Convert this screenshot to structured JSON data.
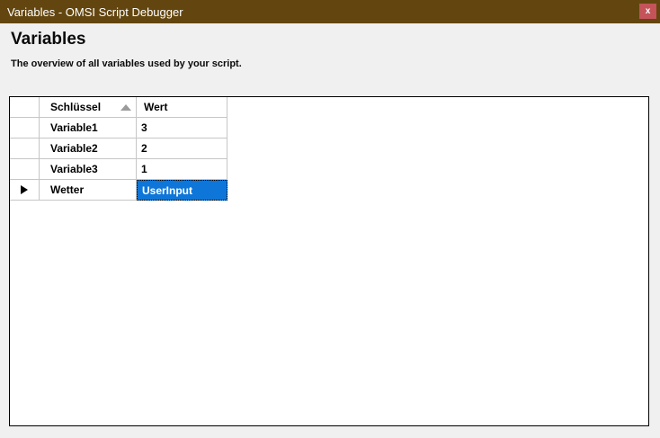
{
  "window": {
    "title": "Variables - OMSI Script Debugger",
    "close_label": "x"
  },
  "header": {
    "title": "Variables",
    "subtitle": "The overview of all variables used by your script."
  },
  "table": {
    "columns": [
      {
        "id": "selector",
        "label": ""
      },
      {
        "id": "schluessel",
        "label": "Schlüssel",
        "sort": "ascending"
      },
      {
        "id": "wert",
        "label": "Wert"
      }
    ],
    "rows": [
      {
        "schluessel": "Variable1",
        "wert": "3",
        "current": false,
        "wert_selected": false
      },
      {
        "schluessel": "Variable2",
        "wert": "2",
        "current": false,
        "wert_selected": false
      },
      {
        "schluessel": "Variable3",
        "wert": "1",
        "current": false,
        "wert_selected": false
      },
      {
        "schluessel": "Wetter",
        "wert": "UserInput",
        "current": true,
        "wert_selected": true
      }
    ]
  },
  "icons": {
    "sort_ascending": "triangle-up",
    "current_row": "triangle-right",
    "close": "x-icon"
  },
  "colors": {
    "titlebar_bg": "#63460f",
    "titlebar_text": "#ffffff",
    "close_button_bg": "#c4545a",
    "selection_bg": "#0e76d8",
    "selection_text": "#ffffff",
    "grid_line": "#c6c6c6",
    "panel_border": "#000000",
    "panel_bg": "#ffffff",
    "window_bg": "#f0f0f0"
  }
}
